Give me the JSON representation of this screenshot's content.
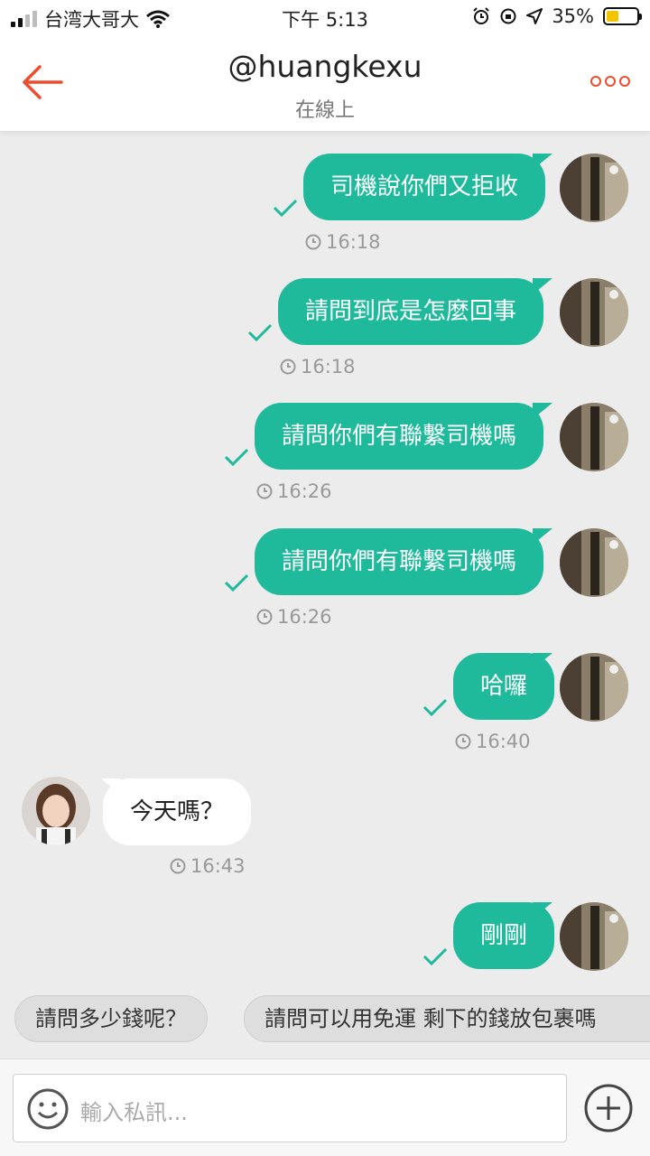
{
  "status_bar": {
    "carrier": "台湾大哥大",
    "time": "下午 5:13",
    "battery": "35%"
  },
  "header": {
    "title": "@huangkexu",
    "subtitle": "在線上"
  },
  "messages": [
    {
      "text": "司機說你們又拒收",
      "time": "16:18"
    },
    {
      "text": "請問到底是怎麼回事",
      "time": "16:18"
    },
    {
      "text": "請問你們有聯繫司機嗎",
      "time": "16:26"
    },
    {
      "text": "請問你們有聯繫司機嗎",
      "time": "16:26"
    },
    {
      "text": "哈囉",
      "time": "16:40"
    },
    {
      "text": "今天嗎？",
      "time": "16:43"
    },
    {
      "text": "剛剛",
      "time": ""
    }
  ],
  "quick_replies": [
    "請問多少錢呢？",
    "請問可以用免運 剩下的錢放包裹嗎"
  ],
  "input": {
    "placeholder": "輸入私訊..."
  },
  "colors": {
    "accent": "#ee4d2d",
    "bubble_out": "#1fba9b",
    "background": "#ececec"
  },
  "icons": {
    "back": "back-arrow-icon",
    "more": "more-options-icon",
    "emoji": "emoji-icon",
    "add": "plus-circle-icon"
  }
}
